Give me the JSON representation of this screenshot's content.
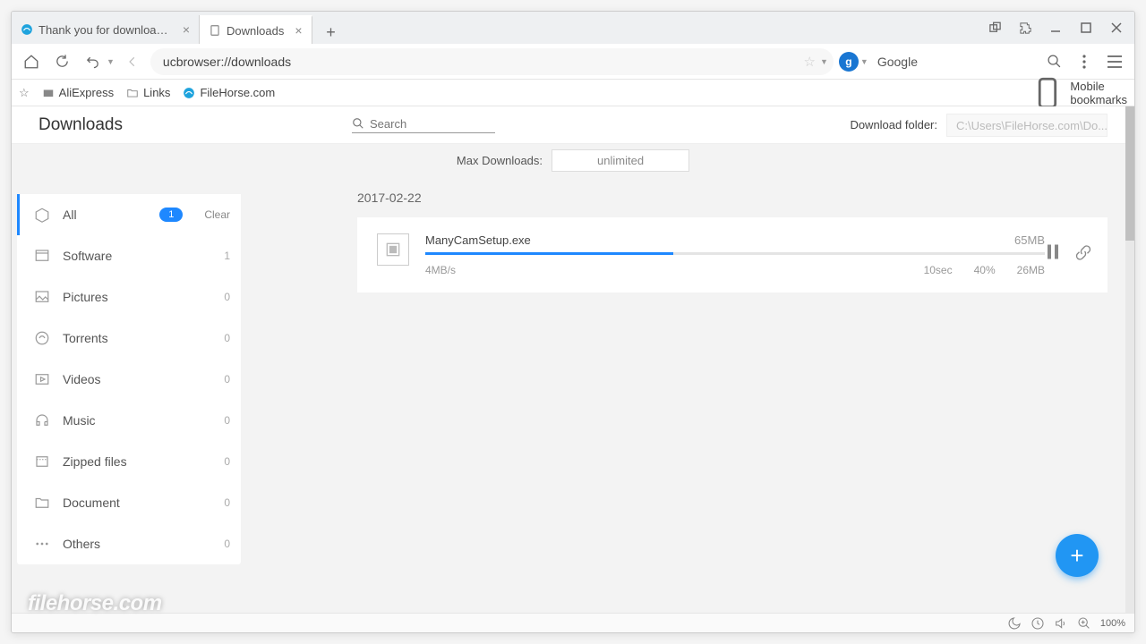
{
  "tabs": [
    {
      "title": "Thank you for downloading N"
    },
    {
      "title": "Downloads"
    }
  ],
  "address_bar": {
    "url": "ucbrowser://downloads"
  },
  "search_engine": {
    "label": "Google"
  },
  "bookmarks": {
    "items": [
      {
        "label": "AliExpress"
      },
      {
        "label": "Links"
      },
      {
        "label": "FileHorse.com"
      }
    ],
    "mobile_label": "Mobile bookmarks"
  },
  "page_title": "Downloads",
  "search_placeholder": "Search",
  "download_folder": {
    "label": "Download folder:",
    "path": "C:\\Users\\FileHorse.com\\Do..."
  },
  "max_downloads": {
    "label": "Max Downloads:",
    "value": "unlimited"
  },
  "categories": [
    {
      "label": "All",
      "count": "1",
      "active": true,
      "clear": "Clear"
    },
    {
      "label": "Software",
      "count": "1"
    },
    {
      "label": "Pictures",
      "count": "0"
    },
    {
      "label": "Torrents",
      "count": "0"
    },
    {
      "label": "Videos",
      "count": "0"
    },
    {
      "label": "Music",
      "count": "0"
    },
    {
      "label": "Zipped files",
      "count": "0"
    },
    {
      "label": "Document",
      "count": "0"
    },
    {
      "label": "Others",
      "count": "0"
    }
  ],
  "group_date": "2017-02-22",
  "download_item": {
    "name": "ManyCamSetup.exe",
    "size": "65MB",
    "speed": "4MB/s",
    "eta": "10sec",
    "percent": "40%",
    "downloaded": "26MB"
  },
  "zoom": "100%",
  "watermark": "filehorse.com"
}
